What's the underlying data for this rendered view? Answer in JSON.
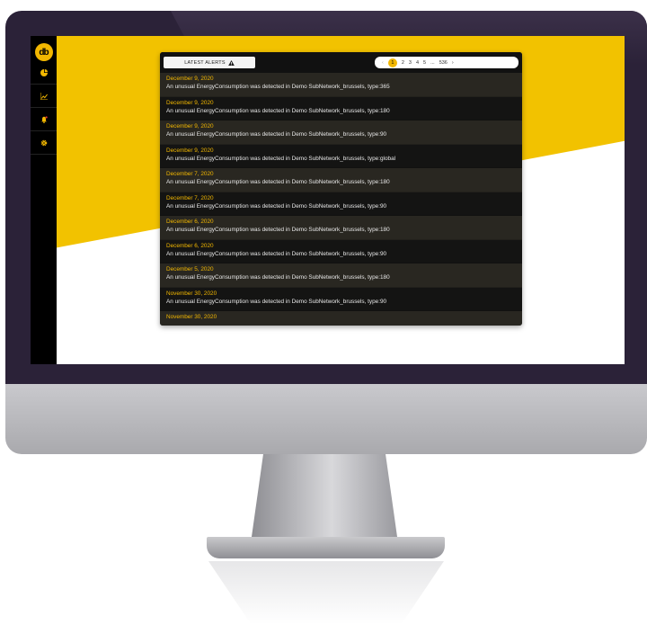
{
  "sidebar": {
    "logo_text": "db",
    "items": [
      {
        "icon": "pie-chart-icon"
      },
      {
        "icon": "line-chart-icon"
      },
      {
        "icon": "bell-icon"
      },
      {
        "icon": "gear-icon"
      }
    ]
  },
  "panel": {
    "header_label": "LATEST ALERTS",
    "header_icon": "warning-icon",
    "pager": {
      "prev": "‹",
      "pages": [
        "1",
        "2",
        "3",
        "4",
        "5"
      ],
      "active_page": "1",
      "ellipsis": "...",
      "last_page": "536",
      "next": "›"
    }
  },
  "alerts": [
    {
      "date": "December 9, 2020",
      "message": "An unusual EnergyConsumption was detected in Demo SubNetwork_brussels, type:365"
    },
    {
      "date": "December 9, 2020",
      "message": "An unusual EnergyConsumption was detected in Demo SubNetwork_brussels, type:180"
    },
    {
      "date": "December 9, 2020",
      "message": "An unusual EnergyConsumption was detected in Demo SubNetwork_brussels, type:90"
    },
    {
      "date": "December 9, 2020",
      "message": "An unusual EnergyConsumption was detected in Demo SubNetwork_brussels, type:global"
    },
    {
      "date": "December 7, 2020",
      "message": "An unusual EnergyConsumption was detected in Demo SubNetwork_brussels, type:180"
    },
    {
      "date": "December 7, 2020",
      "message": "An unusual EnergyConsumption was detected in Demo SubNetwork_brussels, type:90"
    },
    {
      "date": "December 6, 2020",
      "message": "An unusual EnergyConsumption was detected in Demo SubNetwork_brussels, type:180"
    },
    {
      "date": "December 6, 2020",
      "message": "An unusual EnergyConsumption was detected in Demo SubNetwork_brussels, type:90"
    },
    {
      "date": "December 5, 2020",
      "message": "An unusual EnergyConsumption was detected in Demo SubNetwork_brussels, type:180"
    },
    {
      "date": "November 30, 2020",
      "message": "An unusual EnergyConsumption was detected in Demo SubNetwork_brussels, type:90"
    },
    {
      "date": "November 30, 2020",
      "message": ""
    }
  ],
  "colors": {
    "accent": "#f2b700",
    "sidebar": "#000000",
    "bezel": "#2b2238"
  }
}
